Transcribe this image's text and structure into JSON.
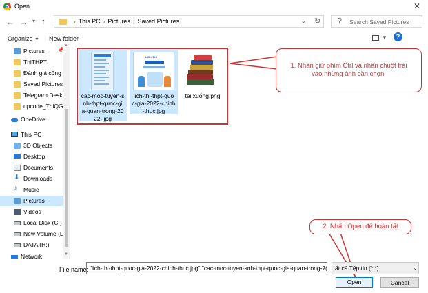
{
  "window": {
    "title": "Open"
  },
  "address": {
    "breadcrumb": [
      "This PC",
      "Pictures",
      "Saved Pictures"
    ]
  },
  "search": {
    "placeholder": "Search Saved Pictures"
  },
  "toolbar": {
    "organize_label": "Organize",
    "new_folder_label": "New folder"
  },
  "nav": {
    "items": [
      {
        "label": "Pictures",
        "icon": "pictures-icon",
        "pinned": true
      },
      {
        "label": "ThiTHPT",
        "icon": "folder-icon"
      },
      {
        "label": "Đánh giá công c",
        "icon": "folder-icon"
      },
      {
        "label": "Saved Pictures",
        "icon": "folder-icon"
      },
      {
        "label": "Telegram Deskto",
        "icon": "folder-icon"
      },
      {
        "label": "upcode_ThiQG_",
        "icon": "folder-icon"
      },
      {
        "label": "OneDrive",
        "icon": "onedrive-icon"
      },
      {
        "label": "This PC",
        "icon": "this-pc-icon"
      },
      {
        "label": "3D Objects",
        "icon": "3d-objects-icon"
      },
      {
        "label": "Desktop",
        "icon": "desktop-icon"
      },
      {
        "label": "Documents",
        "icon": "documents-icon"
      },
      {
        "label": "Downloads",
        "icon": "downloads-icon"
      },
      {
        "label": "Music",
        "icon": "music-icon"
      },
      {
        "label": "Pictures",
        "icon": "pictures-icon",
        "selected": true
      },
      {
        "label": "Videos",
        "icon": "videos-icon"
      },
      {
        "label": "Local Disk (C:)",
        "icon": "drive-icon"
      },
      {
        "label": "New Volume (D:",
        "icon": "drive-icon"
      },
      {
        "label": "DATA (H:)",
        "icon": "drive-icon"
      },
      {
        "label": "Network",
        "icon": "network-icon"
      }
    ]
  },
  "files": [
    {
      "name": "cac-moc-tuyen-snh-thpt-quoc-gia-quan-trong-2022-.jpg",
      "name_lines": [
        "cac-moc-tuyen-s",
        "nh-thpt-quoc-gi",
        "a-quan-trong-20",
        "22-.jpg"
      ],
      "selected": true
    },
    {
      "name": "lich-thi-thpt-quoc-gia-2022-chinh-thuc.jpg",
      "name_lines": [
        "lich-thi-thpt-quo",
        "c-gia-2022-chinh",
        "-thuc.jpg"
      ],
      "selected": true,
      "thumb_title": "LỊCH THI"
    },
    {
      "name": "tải xuống.png",
      "name_lines": [
        "tải xuống.png"
      ],
      "selected": false
    }
  ],
  "annotations": [
    {
      "text": "1. Nhấn giữ phím Ctrl và nhấn chuột trái vào những ảnh cần chọn."
    },
    {
      "text": "2. Nhấn Open để hoàn tất"
    }
  ],
  "footer": {
    "file_name_label": "File name:",
    "file_name_value": "\"lich-thi-thpt-quoc-gia-2022-chinh-thuc.jpg\" \"cac-moc-tuyen-snh-thpt-quoc-gia-quan-trong-2(",
    "file_type_value": "ất cả Tệp tin (*.*)",
    "open_label": "Open",
    "cancel_label": "Cancel"
  },
  "colors": {
    "annotation": "#cc3333",
    "selection": "#cce8ff",
    "accent": "#0078d7",
    "folder": "#f2c75c"
  }
}
